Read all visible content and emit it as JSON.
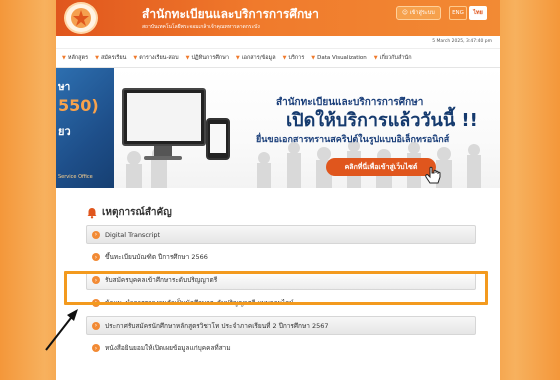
{
  "header": {
    "title": "สำนักทะเบียนและบริการการศึกษา",
    "subtitle": "สถาบันเทคโนโลยีพระจอมเกล้าเจ้าคุณทหารลาดกระบัง",
    "login_label": "เข้าสู่ระบบ",
    "lang_en": "ENG",
    "lang_th": "ไทย",
    "date": "5 March 2025, 3:47:40 pm"
  },
  "nav": {
    "items": [
      {
        "label": "หลักสูตร"
      },
      {
        "label": "สมัครเรียน"
      },
      {
        "label": "ตารางเรียน-สอบ"
      },
      {
        "label": "ปฏิทินการศึกษา"
      },
      {
        "label": "เอกสาร/ข้อมูล"
      },
      {
        "label": "บริการ"
      },
      {
        "label": "Data Visualization"
      },
      {
        "label": "เกี่ยวกับสำนัก"
      }
    ]
  },
  "banner": {
    "left_line1": "ษา",
    "left_line2": "550)",
    "left_line3": "ยว",
    "left_footer": "Service Office",
    "headline1": "สำนักทะเบียนและบริการการศึกษา",
    "headline2": "เปิดให้บริการแล้ววันนี้ !!",
    "headline3": "ยื่นขอเอกสารทรานสคริปต์ในรูปแบบอิเล็กทรอนิกส์",
    "cta_label": "คลิกที่นี่เพื่อเข้าสู่เว็บไซต์"
  },
  "news": {
    "title": "เหตุการณ์สำคัญ",
    "items": [
      {
        "label": "Digital Transcript"
      },
      {
        "label": "ขึ้นทะเบียนบัณฑิต ปีการศึกษา 2566"
      },
      {
        "label": "รับสมัครบุคคลเข้าศึกษาระดับปริญญาตรี"
      },
      {
        "label": "ข้อแนะนำการรายงานตัวเป็นนักศึกษาระดับปริญญาตรี แบบออนไลน์"
      },
      {
        "label": "ประกาศรับสมัครนักศึกษาหลักสูตรวิชาโท ประจำภาคเรียนที่ 2 ปีการศึกษา 2567"
      },
      {
        "label": "หนังสือยินยอมให้เปิดเผยข้อมูลแก่บุคคลที่สาม"
      }
    ]
  },
  "colors": {
    "accent": "#f07a2c",
    "highlight": "#f39a1e",
    "navy": "#153a6e"
  }
}
